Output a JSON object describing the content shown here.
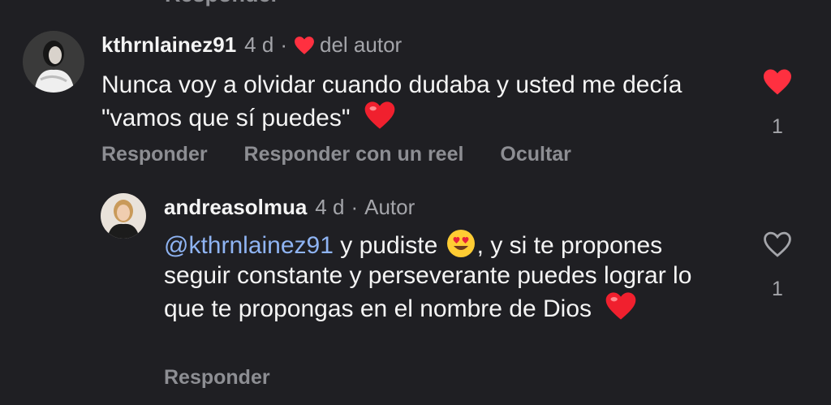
{
  "top_cut": {
    "label": "Responder"
  },
  "comment1": {
    "username": "kthrnlainez91",
    "age": "4 d",
    "sep": "·",
    "liked_by_author": "del autor",
    "text": "Nunca voy a olvidar cuando dudaba y usted me decía \"vamos que sí puedes\"",
    "like_count": "1",
    "liked": true,
    "actions": {
      "reply": "Responder",
      "reply_reel": "Responder con un reel",
      "hide": "Ocultar"
    }
  },
  "comment2": {
    "username": "andreasolmua",
    "age": "4 d",
    "sep": "·",
    "badge": "Autor",
    "mention": "@kthrnlainez91",
    "text_before_emoji": "y pudiste",
    "text_after_emoji": ", y si te propones seguir constante y perseverante puedes lograr lo que te propongas en el nombre de Dios",
    "like_count": "1",
    "liked": false,
    "actions": {
      "reply": "Responder"
    }
  },
  "colors": {
    "background": "#1f1f23",
    "heart": "#ff3040",
    "mention": "#8fb4f3",
    "muted": "#8d8e93"
  }
}
